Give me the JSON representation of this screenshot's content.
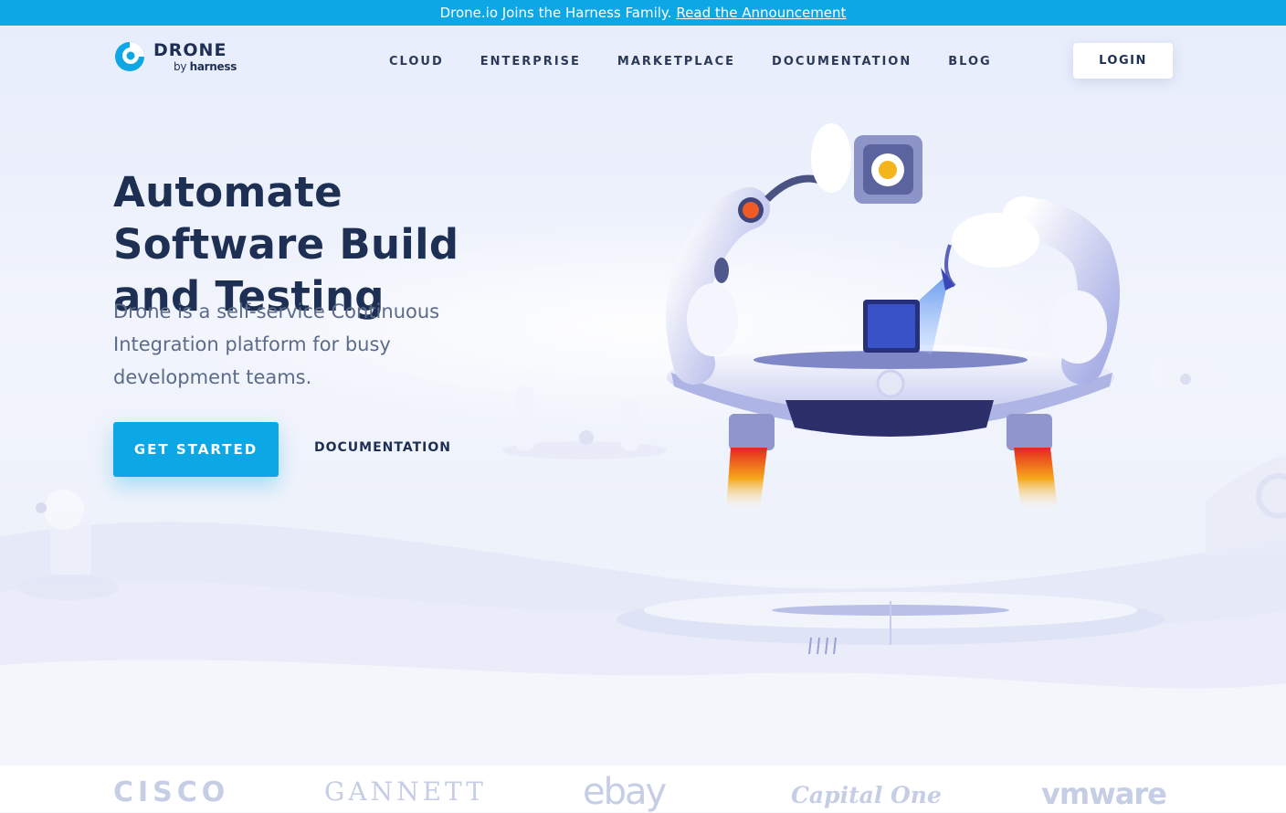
{
  "announcement": {
    "text": "Drone.io Joins the Harness Family.",
    "link": "Read the Announcement"
  },
  "brand": {
    "name": "DRONE",
    "by": "by",
    "parent": "harness"
  },
  "nav": {
    "items": [
      "CLOUD",
      "ENTERPRISE",
      "MARKETPLACE",
      "DOCUMENTATION",
      "BLOG"
    ],
    "login": "LOGIN"
  },
  "hero": {
    "headline": "Automate Software Build and Testing",
    "subtitle": "Drone is a self-service Continuous Integration platform for busy development teams.",
    "cta_primary": "GET STARTED",
    "cta_secondary": "DOCUMENTATION"
  },
  "customers": [
    "CISCO",
    "GANNETT",
    "ebay",
    "Capital One",
    "vmware"
  ],
  "colors": {
    "accent": "#0ea7e6",
    "navy": "#1d2f52",
    "subtext": "#5c6b88",
    "logo_gray": "#c6cee5"
  }
}
